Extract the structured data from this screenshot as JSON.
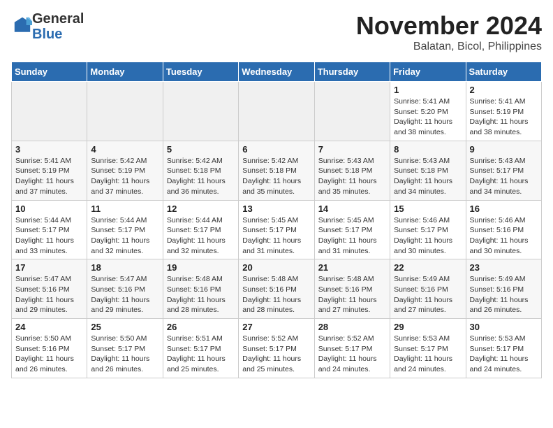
{
  "logo": {
    "general": "General",
    "blue": "Blue"
  },
  "title": {
    "month": "November 2024",
    "location": "Balatan, Bicol, Philippines"
  },
  "headers": [
    "Sunday",
    "Monday",
    "Tuesday",
    "Wednesday",
    "Thursday",
    "Friday",
    "Saturday"
  ],
  "weeks": [
    [
      {
        "day": "",
        "info": ""
      },
      {
        "day": "",
        "info": ""
      },
      {
        "day": "",
        "info": ""
      },
      {
        "day": "",
        "info": ""
      },
      {
        "day": "",
        "info": ""
      },
      {
        "day": "1",
        "info": "Sunrise: 5:41 AM\nSunset: 5:20 PM\nDaylight: 11 hours and 38 minutes."
      },
      {
        "day": "2",
        "info": "Sunrise: 5:41 AM\nSunset: 5:19 PM\nDaylight: 11 hours and 38 minutes."
      }
    ],
    [
      {
        "day": "3",
        "info": "Sunrise: 5:41 AM\nSunset: 5:19 PM\nDaylight: 11 hours and 37 minutes."
      },
      {
        "day": "4",
        "info": "Sunrise: 5:42 AM\nSunset: 5:19 PM\nDaylight: 11 hours and 37 minutes."
      },
      {
        "day": "5",
        "info": "Sunrise: 5:42 AM\nSunset: 5:18 PM\nDaylight: 11 hours and 36 minutes."
      },
      {
        "day": "6",
        "info": "Sunrise: 5:42 AM\nSunset: 5:18 PM\nDaylight: 11 hours and 35 minutes."
      },
      {
        "day": "7",
        "info": "Sunrise: 5:43 AM\nSunset: 5:18 PM\nDaylight: 11 hours and 35 minutes."
      },
      {
        "day": "8",
        "info": "Sunrise: 5:43 AM\nSunset: 5:18 PM\nDaylight: 11 hours and 34 minutes."
      },
      {
        "day": "9",
        "info": "Sunrise: 5:43 AM\nSunset: 5:17 PM\nDaylight: 11 hours and 34 minutes."
      }
    ],
    [
      {
        "day": "10",
        "info": "Sunrise: 5:44 AM\nSunset: 5:17 PM\nDaylight: 11 hours and 33 minutes."
      },
      {
        "day": "11",
        "info": "Sunrise: 5:44 AM\nSunset: 5:17 PM\nDaylight: 11 hours and 32 minutes."
      },
      {
        "day": "12",
        "info": "Sunrise: 5:44 AM\nSunset: 5:17 PM\nDaylight: 11 hours and 32 minutes."
      },
      {
        "day": "13",
        "info": "Sunrise: 5:45 AM\nSunset: 5:17 PM\nDaylight: 11 hours and 31 minutes."
      },
      {
        "day": "14",
        "info": "Sunrise: 5:45 AM\nSunset: 5:17 PM\nDaylight: 11 hours and 31 minutes."
      },
      {
        "day": "15",
        "info": "Sunrise: 5:46 AM\nSunset: 5:17 PM\nDaylight: 11 hours and 30 minutes."
      },
      {
        "day": "16",
        "info": "Sunrise: 5:46 AM\nSunset: 5:16 PM\nDaylight: 11 hours and 30 minutes."
      }
    ],
    [
      {
        "day": "17",
        "info": "Sunrise: 5:47 AM\nSunset: 5:16 PM\nDaylight: 11 hours and 29 minutes."
      },
      {
        "day": "18",
        "info": "Sunrise: 5:47 AM\nSunset: 5:16 PM\nDaylight: 11 hours and 29 minutes."
      },
      {
        "day": "19",
        "info": "Sunrise: 5:48 AM\nSunset: 5:16 PM\nDaylight: 11 hours and 28 minutes."
      },
      {
        "day": "20",
        "info": "Sunrise: 5:48 AM\nSunset: 5:16 PM\nDaylight: 11 hours and 28 minutes."
      },
      {
        "day": "21",
        "info": "Sunrise: 5:48 AM\nSunset: 5:16 PM\nDaylight: 11 hours and 27 minutes."
      },
      {
        "day": "22",
        "info": "Sunrise: 5:49 AM\nSunset: 5:16 PM\nDaylight: 11 hours and 27 minutes."
      },
      {
        "day": "23",
        "info": "Sunrise: 5:49 AM\nSunset: 5:16 PM\nDaylight: 11 hours and 26 minutes."
      }
    ],
    [
      {
        "day": "24",
        "info": "Sunrise: 5:50 AM\nSunset: 5:16 PM\nDaylight: 11 hours and 26 minutes."
      },
      {
        "day": "25",
        "info": "Sunrise: 5:50 AM\nSunset: 5:17 PM\nDaylight: 11 hours and 26 minutes."
      },
      {
        "day": "26",
        "info": "Sunrise: 5:51 AM\nSunset: 5:17 PM\nDaylight: 11 hours and 25 minutes."
      },
      {
        "day": "27",
        "info": "Sunrise: 5:52 AM\nSunset: 5:17 PM\nDaylight: 11 hours and 25 minutes."
      },
      {
        "day": "28",
        "info": "Sunrise: 5:52 AM\nSunset: 5:17 PM\nDaylight: 11 hours and 24 minutes."
      },
      {
        "day": "29",
        "info": "Sunrise: 5:53 AM\nSunset: 5:17 PM\nDaylight: 11 hours and 24 minutes."
      },
      {
        "day": "30",
        "info": "Sunrise: 5:53 AM\nSunset: 5:17 PM\nDaylight: 11 hours and 24 minutes."
      }
    ]
  ]
}
